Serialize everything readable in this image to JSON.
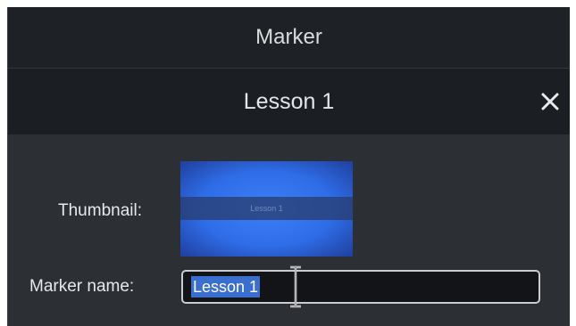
{
  "window": {
    "title": "Marker"
  },
  "marker": {
    "title": "Lesson 1",
    "close_icon": "close-icon"
  },
  "form": {
    "thumbnail_label": "Thumbnail:",
    "thumbnail_caption": "Lesson 1",
    "name_label": "Marker name:",
    "name_value": "Lesson 1"
  },
  "colors": {
    "header_bg": "#1e2125",
    "subheader_bg": "#1b1e22",
    "body_bg": "#2c3035",
    "selection": "#3a6fcf",
    "thumbnail_blue": "#2f6de8"
  }
}
